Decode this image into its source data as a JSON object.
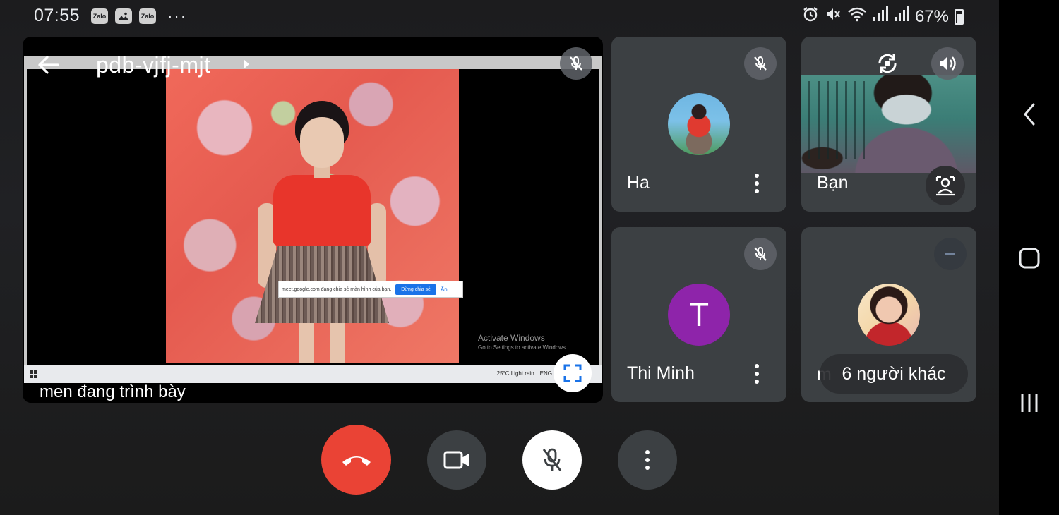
{
  "status_bar": {
    "time": "07:55",
    "left_icons": [
      "zalo-icon",
      "gallery-icon",
      "zalo-icon"
    ],
    "zalo_label": "Zalo",
    "more_dots": "···",
    "battery": "67%"
  },
  "meeting": {
    "code": "pdb-vjfj-mjt",
    "presenter_caption": "men đang trình bày"
  },
  "screen_share": {
    "banner_text": "meet.google.com đang chia sẻ màn hình của bạn.",
    "banner_stop": "Dừng chia sẻ",
    "banner_hide": "Ẩn",
    "activate_title": "Activate Windows",
    "activate_sub": "Go to Settings to activate Windows.",
    "taskbar_weather": "25°C  Light rain",
    "taskbar_lang": "ENG"
  },
  "participants": [
    {
      "name": "Ha",
      "muted": true
    },
    {
      "name": "Bạn",
      "self": true
    },
    {
      "name": "Thi Minh",
      "avatar_letter": "T",
      "avatar_color": "#8e24aa",
      "muted": true
    },
    {
      "name": "m",
      "more_label": "6 người khác"
    }
  ],
  "colors": {
    "end_call": "#ea4335",
    "tile_bg": "#3c4043",
    "accent_blue": "#1a73e8"
  }
}
